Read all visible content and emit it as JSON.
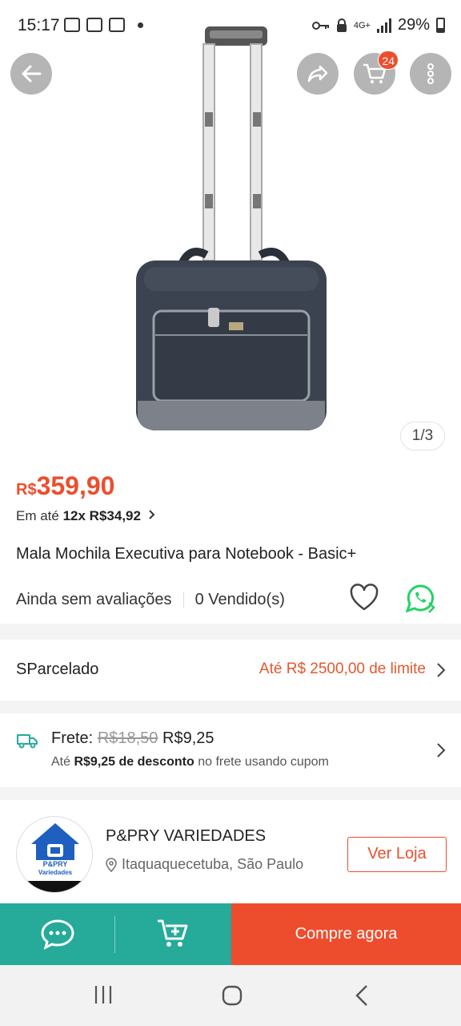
{
  "status_bar": {
    "time": "15:17",
    "network": "4G+",
    "battery": "29%"
  },
  "header": {
    "back_icon": "arrow-left-icon",
    "share_icon": "share-icon",
    "cart_icon": "cart-icon",
    "cart_badge": "24",
    "more_icon": "more-vertical-icon"
  },
  "gallery": {
    "counter": "1/3"
  },
  "product": {
    "currency": "R$",
    "price": "359,90",
    "installments_prefix": "Em até",
    "installments_value": "12x R$34,92",
    "title": "Mala Mochila Executiva para Notebook - Basic+",
    "reviews": "Ainda sem avaliações",
    "sold": "0 Vendido(s)"
  },
  "sparcelado": {
    "label": "SParcelado",
    "limit": "Até R$ 2500,00 de limite"
  },
  "shipping": {
    "label": "Frete:",
    "old_price": "R$18,50",
    "new_price": "R$9,25",
    "note_prefix": "Até",
    "note_bold": "R$9,25 de desconto",
    "note_suffix": "no frete usando cupom"
  },
  "store": {
    "name": "P&PRY VARIEDADES",
    "location": "Itaquaquecetuba, São Paulo",
    "logo_text_1": "P&PRY",
    "logo_text_2": "Variedades",
    "button": "Ver Loja"
  },
  "bottom_bar": {
    "buy_now": "Compre agora"
  },
  "colors": {
    "accent": "#ee4d2d",
    "teal": "#26aa99",
    "whatsapp": "#25d366"
  }
}
